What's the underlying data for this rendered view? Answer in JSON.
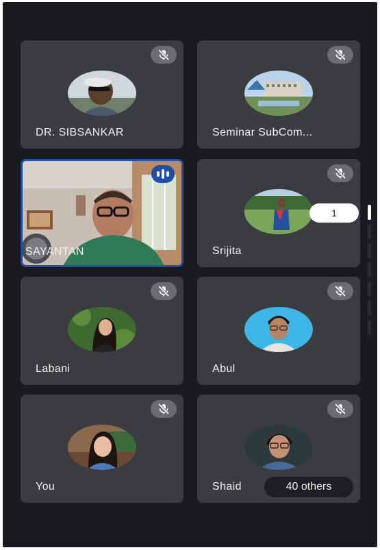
{
  "participants": [
    {
      "name": "DR. SIBSANKAR"
    },
    {
      "name": "Seminar SubCom..."
    },
    {
      "name": "SAYANTAN"
    },
    {
      "name": "Srijita"
    },
    {
      "name": "Labani"
    },
    {
      "name": "Abul"
    },
    {
      "name": "You"
    },
    {
      "name": "Shaid"
    }
  ],
  "overflow": {
    "label": "40 others"
  },
  "page_indicator": {
    "value": "1"
  },
  "icons": {
    "muted": "mic-off-icon",
    "speaking": "audio-level-icon"
  },
  "colors": {
    "background": "#1a1b1f",
    "tile": "#3b3c40",
    "active_speaker_border": "#1e4ea8"
  }
}
